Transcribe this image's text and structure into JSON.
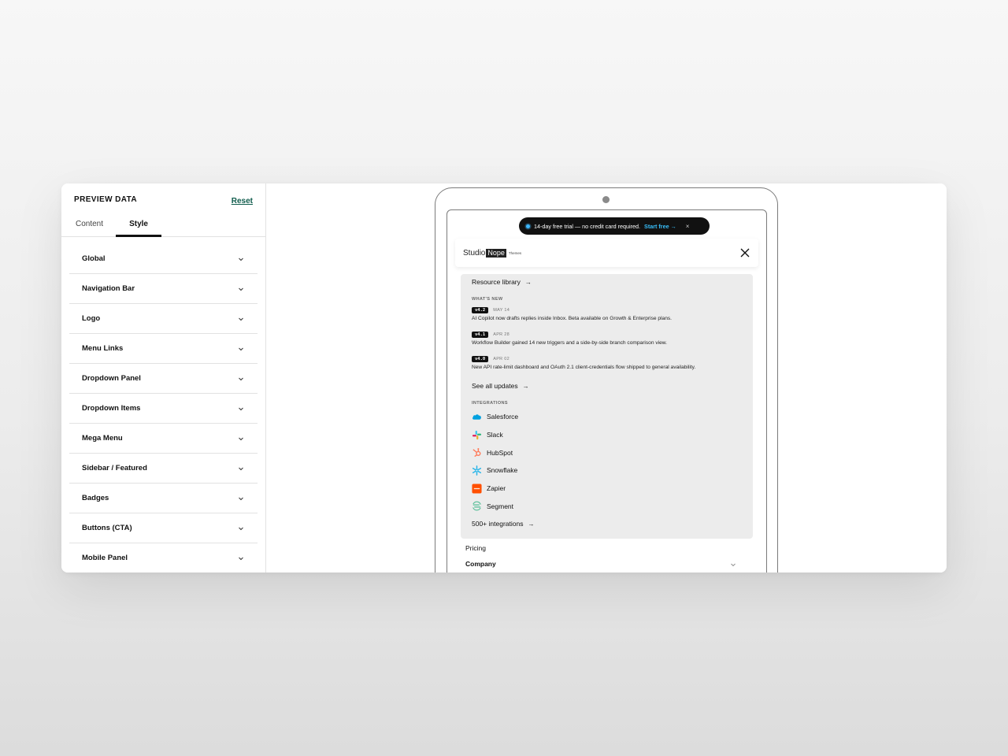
{
  "sidebar": {
    "title": "PREVIEW DATA",
    "reset_label": "Reset",
    "tabs": [
      {
        "label": "Content",
        "active": false
      },
      {
        "label": "Style",
        "active": true
      }
    ],
    "sections": [
      {
        "label": "Global"
      },
      {
        "label": "Navigation Bar"
      },
      {
        "label": "Logo"
      },
      {
        "label": "Menu Links"
      },
      {
        "label": "Dropdown Panel"
      },
      {
        "label": "Dropdown Items"
      },
      {
        "label": "Mega Menu"
      },
      {
        "label": "Sidebar / Featured"
      },
      {
        "label": "Badges"
      },
      {
        "label": "Buttons (CTA)"
      },
      {
        "label": "Mobile Panel"
      }
    ]
  },
  "preview": {
    "promo": {
      "text": "14-day free trial — no credit card required.",
      "cta": "Start free →",
      "close": "×"
    },
    "logo": {
      "word": "Studio",
      "box": "Nope",
      "suffix": "Themes"
    },
    "panel": {
      "resource_link": "Resource library",
      "whats_new_caption": "WHAT'S NEW",
      "updates": [
        {
          "version": "v4.2",
          "date": "MAY 14",
          "text": "AI Copilot now drafts replies inside Inbox. Beta available on Growth & Enterprise plans."
        },
        {
          "version": "v4.1",
          "date": "APR 28",
          "text": "Workflow Builder gained 14 new triggers and a side-by-side branch comparison view."
        },
        {
          "version": "v4.0",
          "date": "APR 02",
          "text": "New API rate-limit dashboard and OAuth 2.1 client-credentials flow shipped to general availability."
        }
      ],
      "see_all": "See all updates",
      "integrations_caption": "INTEGRATIONS",
      "integrations": [
        {
          "name": "Salesforce",
          "icon": "salesforce-icon",
          "color": "#00a1e0"
        },
        {
          "name": "Slack",
          "icon": "slack-icon",
          "color": "#4a154b"
        },
        {
          "name": "HubSpot",
          "icon": "hubspot-icon",
          "color": "#ff7a59"
        },
        {
          "name": "Snowflake",
          "icon": "snowflake-icon",
          "color": "#29b5e8"
        },
        {
          "name": "Zapier",
          "icon": "zapier-icon",
          "color": "#ff4f00"
        },
        {
          "name": "Segment",
          "icon": "segment-icon",
          "color": "#52bd95"
        }
      ],
      "more_integrations": "500+ integrations"
    },
    "menu": {
      "pricing": "Pricing",
      "company": "Company"
    }
  },
  "colors": {
    "accent_link": "#0f5c4c",
    "promo_cta": "#38bdf8",
    "panel_bg": "#ececec"
  }
}
